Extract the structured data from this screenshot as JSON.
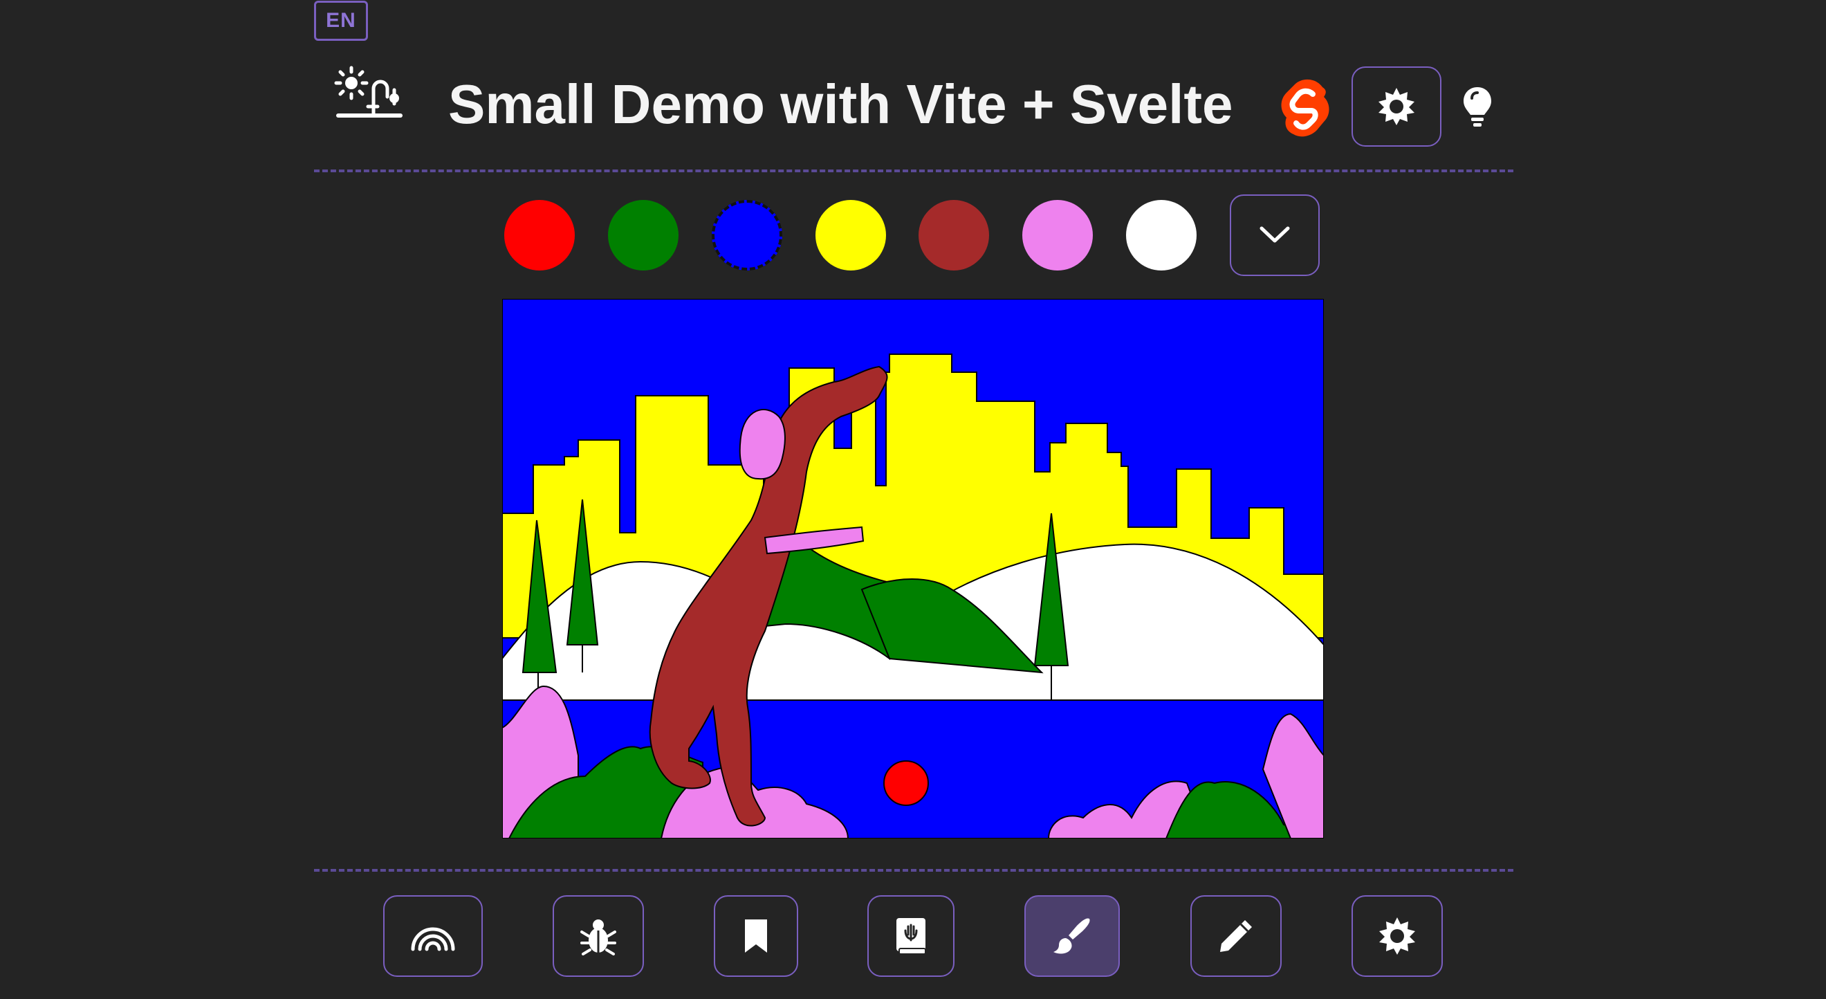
{
  "header": {
    "lang": "EN",
    "title": "Small Demo with Vite + Svelte",
    "logo_icon": "sun-tree-icon",
    "brand_icon": "svelte-logo",
    "theme_button_icon": "sun-icon",
    "hint_icon": "lightbulb-icon"
  },
  "palette": {
    "colors": [
      {
        "name": "red",
        "hex": "#ff0000"
      },
      {
        "name": "green",
        "hex": "#008000"
      },
      {
        "name": "blue",
        "hex": "#0000ff",
        "selected": true
      },
      {
        "name": "yellow",
        "hex": "#ffff00"
      },
      {
        "name": "brown",
        "hex": "#a52a2a"
      },
      {
        "name": "violet",
        "hex": "#ee82ee"
      },
      {
        "name": "white",
        "hex": "#ffffff"
      }
    ],
    "more_icon": "chevron-down-icon"
  },
  "illustration": {
    "subject": "dog-in-city-park",
    "sky": "#0000ff",
    "buildings": "#ffff00",
    "hills": "#ffffff",
    "trees": "#008000",
    "dog": "#a52a2a",
    "collar": "#ee82ee",
    "ball": "#ff0000",
    "water": "#0000ff",
    "bushes": "#ee82ee"
  },
  "toolbar": {
    "buttons": [
      {
        "icon": "rainbow-icon"
      },
      {
        "icon": "bug-icon"
      },
      {
        "icon": "bookmark-icon"
      },
      {
        "icon": "book-icon"
      },
      {
        "icon": "paintbrush-icon",
        "active": true
      },
      {
        "icon": "pencil-icon"
      },
      {
        "icon": "sun-icon"
      }
    ]
  },
  "colors": {
    "accent": "#7a5fc0",
    "background": "#242424",
    "divider": "#5b4a96",
    "svelte": "#ff3e00"
  }
}
